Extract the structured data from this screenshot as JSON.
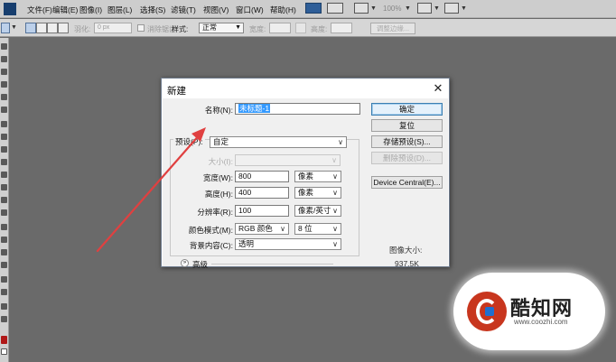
{
  "menubar": {
    "items": [
      "文件(F)",
      "编辑(E)",
      "图像(I)",
      "图层(L)",
      "选择(S)",
      "滤镜(T)",
      "视图(V)",
      "窗口(W)",
      "帮助(H)"
    ],
    "zoom": "100%"
  },
  "options_bar": {
    "feather_label": "羽化:",
    "feather_value": "0 px",
    "antialias_label": "消除锯齿",
    "style_label": "样式:",
    "style_value": "正常",
    "width_label": "宽度:",
    "height_label": "高度:",
    "refine_button": "调整边缘..."
  },
  "dialog": {
    "title": "新建",
    "name_label": "名称(N):",
    "name_value": "未标题-1",
    "preset_label": "预设(P):",
    "preset_value": "自定",
    "size_label": "大小(I):",
    "width_label": "宽度(W):",
    "width_value": "800",
    "width_unit": "像素",
    "height_label": "高度(H):",
    "height_value": "400",
    "height_unit": "像素",
    "resolution_label": "分辨率(R):",
    "resolution_value": "100",
    "resolution_unit": "像素/英寸",
    "color_mode_label": "颜色模式(M):",
    "color_mode_value": "RGB 颜色",
    "bit_depth_value": "8 位",
    "background_label": "背景内容(C):",
    "background_value": "透明",
    "advanced_label": "高级",
    "buttons": {
      "ok": "确定",
      "reset": "复位",
      "save_preset": "存储预设(S)...",
      "delete_preset": "删除预设(D)...",
      "device_central": "Device Central(E)..."
    },
    "image_size_label": "图像大小:",
    "image_size_value": "937.5K"
  },
  "watermark": {
    "name": "酷知网",
    "url": "www.coozhi.com"
  },
  "colors": {
    "workspace": "#6a6a6a",
    "annotation_arrow": "#e04040",
    "name_highlight": "#3399ff"
  }
}
